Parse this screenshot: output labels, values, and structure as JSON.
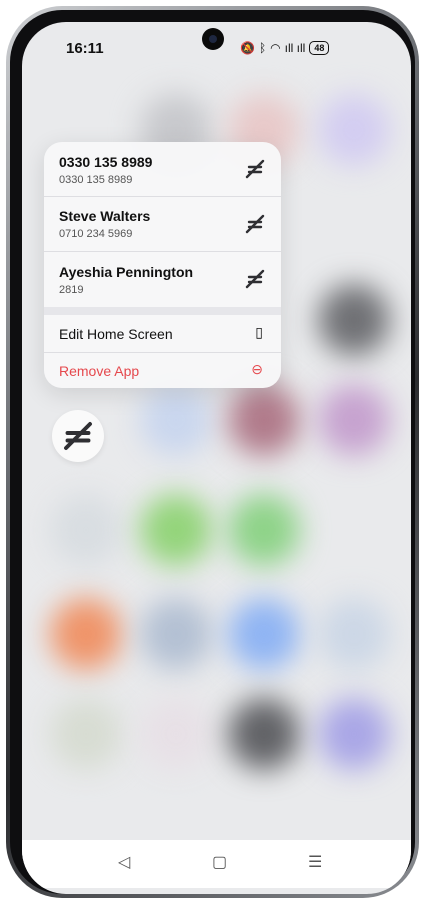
{
  "status_bar": {
    "time": "16:11",
    "signal": "ıll ıll",
    "battery": "48"
  },
  "shortcut_menu": {
    "contacts": [
      {
        "title": "0330 135 8989",
        "subtitle": "0330 135 8989"
      },
      {
        "title": "Steve Walters",
        "subtitle": "0710 234 5969"
      },
      {
        "title": "Ayeshia Pennington",
        "subtitle": "2819"
      }
    ],
    "actions": [
      {
        "label": "Edit Home Screen",
        "icon": "phone-outline-icon",
        "color": "#111111"
      },
      {
        "label": "Remove App",
        "icon": "minus-circle-icon",
        "color": "#e5484d"
      }
    ]
  },
  "nav": {
    "back": "◁",
    "home": "▢",
    "menu": "☰"
  },
  "colors": {
    "danger": "#e5484d",
    "app_icon_glyph": "#2f2f33"
  }
}
